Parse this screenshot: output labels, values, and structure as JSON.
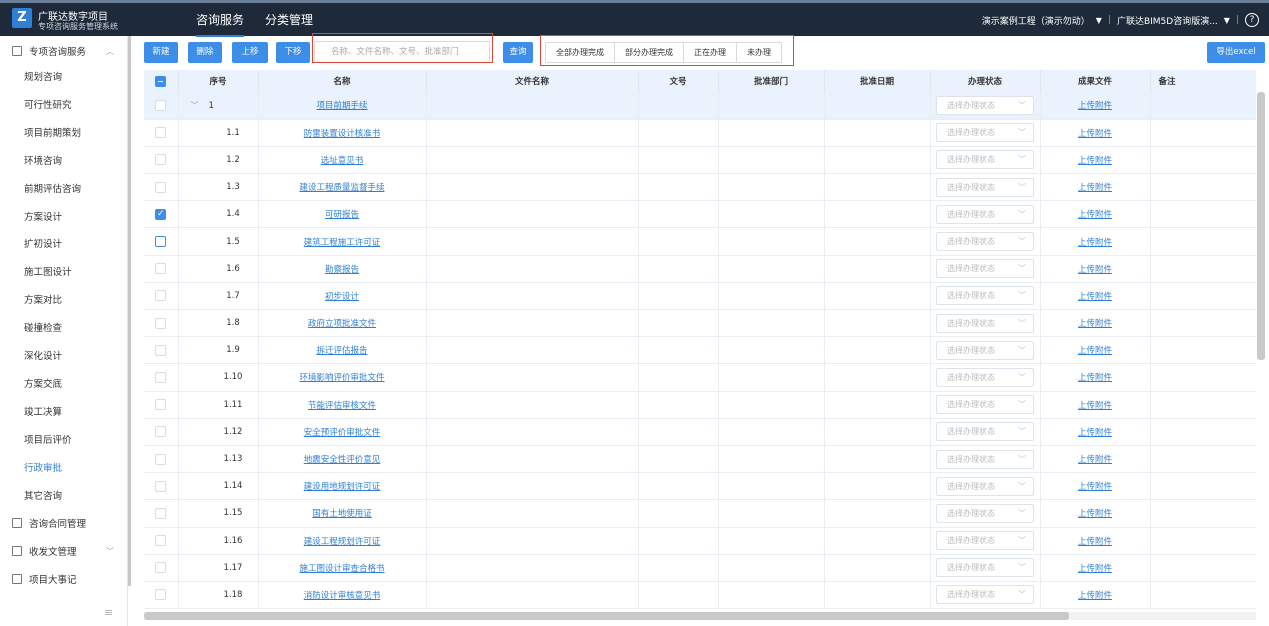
{
  "header": {
    "logo_letter": "Z",
    "title": "广联达数字项目",
    "subtitle": "专项咨询服务管理系统",
    "tabs": [
      "咨询服务",
      "分类管理"
    ],
    "project": "演示案例工程（演示勿动）",
    "org": "广联达BIM5D咨询版演...",
    "help": "?"
  },
  "sidebar": {
    "group1": "专项咨询服务",
    "items": [
      "规划咨询",
      "可行性研究",
      "项目前期策划",
      "环境咨询",
      "前期评估咨询",
      "方案设计",
      "扩初设计",
      "施工图设计",
      "方案对比",
      "碰撞检查",
      "深化设计",
      "方案交底",
      "竣工决算",
      "项目后评价",
      "行政审批",
      "其它咨询"
    ],
    "group2": "咨询合同管理",
    "group3": "收发文管理",
    "group4": "项目大事记",
    "menu_icon": "≡"
  },
  "toolbar": {
    "new": "新建",
    "delete": "删除",
    "up": "上移",
    "down": "下移",
    "search_placeholder": "名称、文件名称、文号、批准部门",
    "query": "查询",
    "filters": [
      "全部办理完成",
      "部分办理完成",
      "正在办理",
      "未办理"
    ],
    "export": "导出excel"
  },
  "table": {
    "headers": {
      "seq": "序号",
      "name": "名称",
      "file_name": "文件名称",
      "doc_no": "文号",
      "dept": "批准部门",
      "date": "批准日期",
      "status": "办理状态",
      "result": "成果文件",
      "note": "备注"
    },
    "status_placeholder": "选择办理状态",
    "upload_label": "上传附件",
    "rows": [
      {
        "seq": "1",
        "name": "项目前期手续"
      },
      {
        "seq": "1.1",
        "name": "防雷装置设计核准书"
      },
      {
        "seq": "1.2",
        "name": "选址意见书"
      },
      {
        "seq": "1.3",
        "name": "建设工程质量监督手续"
      },
      {
        "seq": "1.4",
        "name": "可研报告"
      },
      {
        "seq": "1.5",
        "name": "建筑工程施工许可证"
      },
      {
        "seq": "1.6",
        "name": "勘察报告"
      },
      {
        "seq": "1.7",
        "name": "初步设计"
      },
      {
        "seq": "1.8",
        "name": "政府立项批准文件"
      },
      {
        "seq": "1.9",
        "name": "拆迁评估报告"
      },
      {
        "seq": "1.10",
        "name": "环境影响评价审批文件"
      },
      {
        "seq": "1.11",
        "name": "节能评估审核文件"
      },
      {
        "seq": "1.12",
        "name": "安全预评价审批文件"
      },
      {
        "seq": "1.13",
        "name": "地震安全性评价意见"
      },
      {
        "seq": "1.14",
        "name": "建设用地规划许可证"
      },
      {
        "seq": "1.15",
        "name": "国有土地使用证"
      },
      {
        "seq": "1.16",
        "name": "建设工程规划许可证"
      },
      {
        "seq": "1.17",
        "name": "施工图设计审查合格书"
      },
      {
        "seq": "1.18",
        "name": "消防设计审核意见书"
      }
    ]
  }
}
